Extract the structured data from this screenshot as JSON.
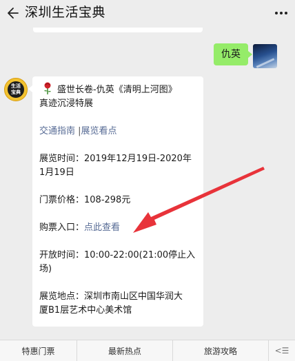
{
  "header": {
    "title": "深圳生活宝典",
    "back_icon": "back-arrow-icon",
    "more_icon": "more-dots-icon"
  },
  "chat": {
    "user_message": "仇英",
    "bot_avatar_text": [
      "生活",
      "宝典"
    ],
    "card": {
      "title": "盛世长卷-仇英《清明上河图》",
      "subtitle": "真迹沉浸特展",
      "link_traffic": "交通指南",
      "link_separator": "|",
      "link_highlights": "展览看点",
      "date_line1": "展览时间：2019年12月19日-2020年",
      "date_line2": "1月19日",
      "price": "门票价格：108-298元",
      "ticket_label": "购票入口：",
      "ticket_link": "点此查看",
      "hours_line1": "开放时间：10:00-22:00(21:00停止入",
      "hours_line2": "场)",
      "venue_line1": "展览地点：深圳市南山区中国华润大",
      "venue_line2": "厦B1层艺术中心美术馆"
    },
    "annotation_arrow_color": "#e8333a"
  },
  "bottom_menu": {
    "tab1": "特惠门票",
    "tab2": "最新热点",
    "tab3": "旅游攻略",
    "tab4_icon": "keyboard-menu-icon"
  }
}
